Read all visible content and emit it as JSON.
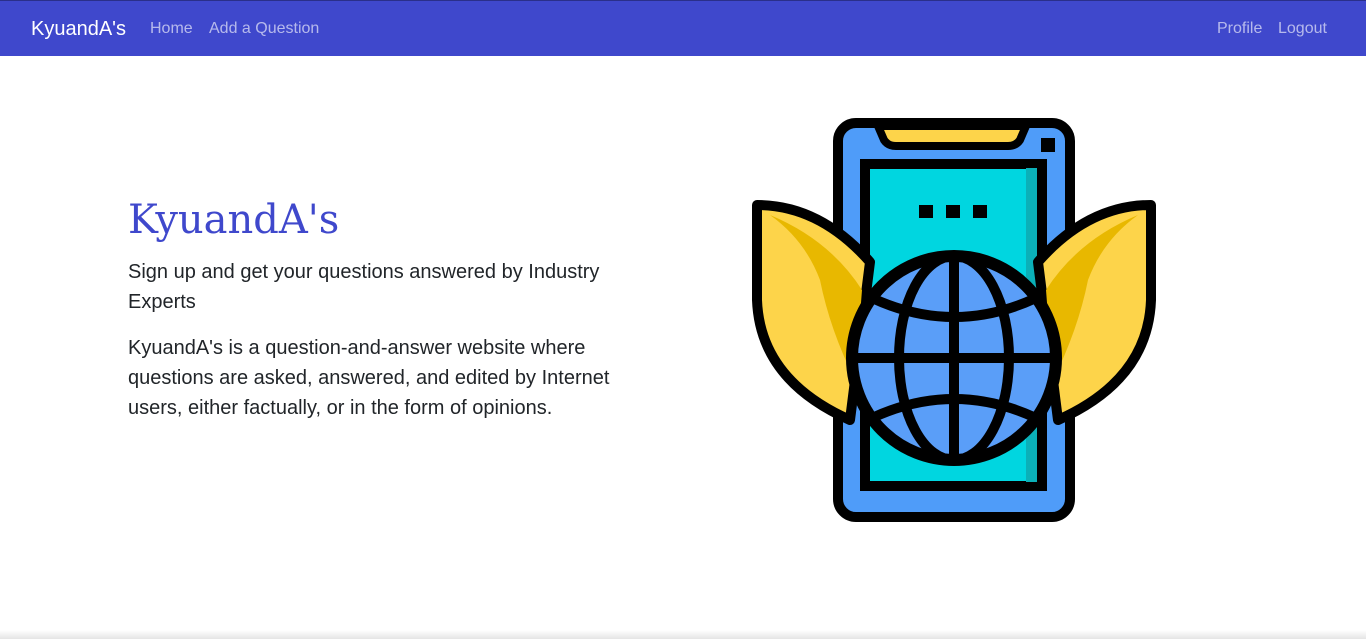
{
  "navbar": {
    "brand": "KyuandA's",
    "links": [
      {
        "label": "Home"
      },
      {
        "label": "Add a Question"
      }
    ],
    "right_links": [
      {
        "label": "Profile"
      },
      {
        "label": "Logout"
      }
    ],
    "background_color": "#3f48cc"
  },
  "hero": {
    "title": "KyuandA's",
    "lead": "Sign up and get your questions answered by Industry Experts",
    "description": "KyuandA's is a question-and-answer website where questions are asked, answered, and edited by Internet users, either factually, or in the form of opinions.",
    "title_color": "#3f48cc",
    "image_icon": "globe-phone-laurel-icon"
  }
}
